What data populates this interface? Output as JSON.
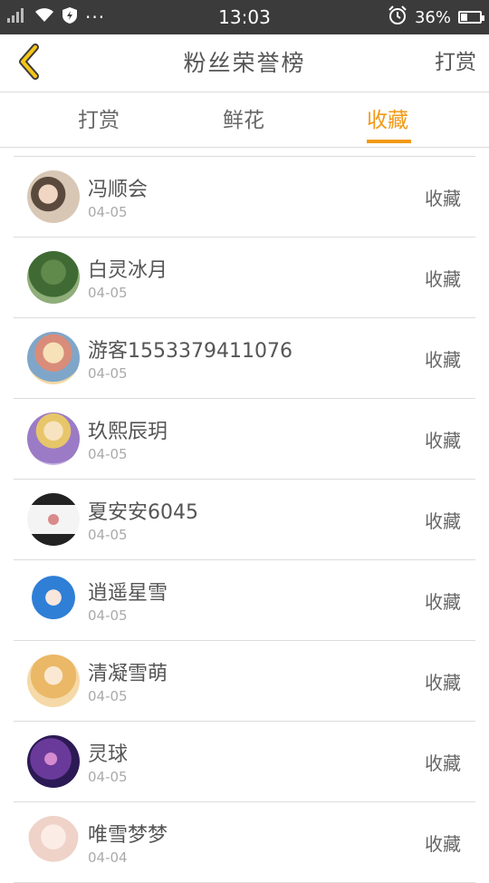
{
  "status_bar": {
    "time": "13:03",
    "battery_text": "36%",
    "battery_level": 0.36,
    "icons": [
      "signal-icon",
      "wifi-icon",
      "shield-icon",
      "more-dots-icon",
      "alarm-icon",
      "battery-icon"
    ],
    "more_dots": "···"
  },
  "nav": {
    "title": "粉丝荣誉榜",
    "right_action": "打赏"
  },
  "tabs": [
    {
      "label": "打赏"
    },
    {
      "label": "鲜花"
    },
    {
      "label": "收藏"
    }
  ],
  "active_tab_color": "#f19a16",
  "fans": [
    {
      "name": "冯顺会",
      "date": "04-05",
      "action": "收藏"
    },
    {
      "name": "白灵冰月",
      "date": "04-05",
      "action": "收藏"
    },
    {
      "name": "游客1553379411076",
      "date": "04-05",
      "action": "收藏"
    },
    {
      "name": "玖熙辰玥",
      "date": "04-05",
      "action": "收藏"
    },
    {
      "name": "夏安安6045",
      "date": "04-05",
      "action": "收藏"
    },
    {
      "name": "逍遥星雪",
      "date": "04-05",
      "action": "收藏"
    },
    {
      "name": "清凝雪萌",
      "date": "04-05",
      "action": "收藏"
    },
    {
      "name": "灵球",
      "date": "04-05",
      "action": "收藏"
    },
    {
      "name": "唯雪梦梦",
      "date": "04-04",
      "action": "收藏"
    }
  ]
}
